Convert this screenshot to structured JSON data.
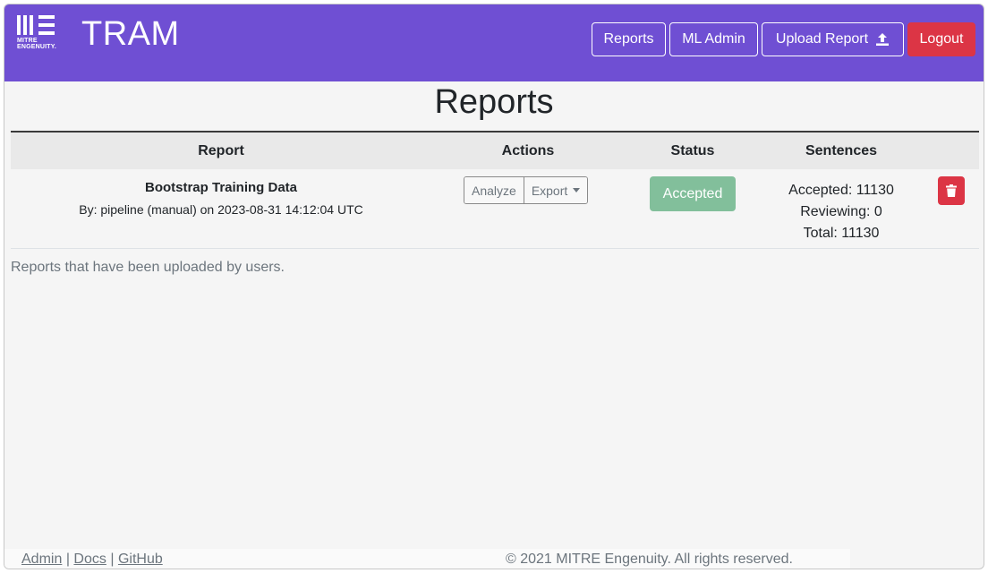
{
  "brand": {
    "logo_text_line1": "MITRE",
    "logo_text_line2": "ENGENUITY.",
    "app_name": "TRAM"
  },
  "nav": {
    "reports": "Reports",
    "ml_admin": "ML Admin",
    "upload_report": "Upload Report",
    "upload_icon": "upload-icon",
    "logout": "Logout"
  },
  "page_title": "Reports",
  "table": {
    "headers": [
      "Report",
      "Actions",
      "Status",
      "Sentences"
    ],
    "rows": [
      {
        "name": "Bootstrap Training Data",
        "meta": "By: pipeline (manual) on 2023-08-31 14:12:04 UTC",
        "actions": {
          "analyze": "Analyze",
          "export": "Export"
        },
        "status": "Accepted",
        "sentences": {
          "accepted": "Accepted: 11130",
          "reviewing": "Reviewing: 0",
          "total": "Total: 11130"
        },
        "delete_icon": "trash-icon"
      }
    ]
  },
  "caption": "Reports that have been uploaded by users.",
  "footer": {
    "admin": "Admin",
    "sep1": "|",
    "docs": "Docs",
    "sep2": "|",
    "github": "GitHub",
    "copyright": "© 2021 MITRE Engenuity. All rights reserved."
  },
  "colors": {
    "navbar": "#6f4fd3",
    "danger": "#dc3545",
    "accepted": "#82bf9b"
  }
}
